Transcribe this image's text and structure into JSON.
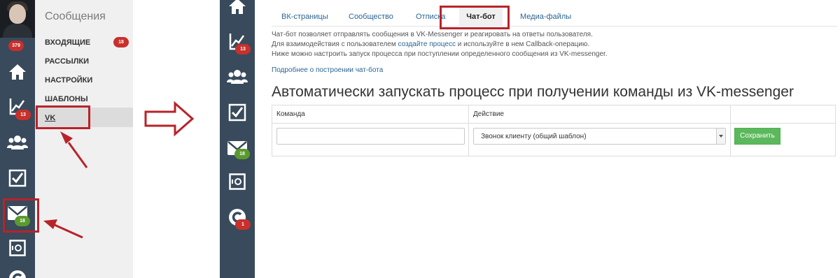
{
  "left_panel": {
    "avatar_badge": "379",
    "rail_badges": {
      "analytics": "13",
      "mail": "18"
    },
    "menu": {
      "title": "Сообщения",
      "items": [
        {
          "label": "ВХОДЯЩИЕ",
          "badge": "18"
        },
        {
          "label": "РАССЫЛКИ"
        },
        {
          "label": "НАСТРОЙКИ"
        },
        {
          "label": "ШАБЛОНЫ"
        },
        {
          "label": "VK",
          "selected": true
        }
      ]
    }
  },
  "right_panel": {
    "rail_badges": {
      "analytics": "13",
      "mail": "18",
      "c": "1"
    },
    "tabs": [
      {
        "label": "ВК-страницы"
      },
      {
        "label": "Сообщество"
      },
      {
        "label": "Отписка"
      },
      {
        "label": "Чат-бот",
        "active": true
      },
      {
        "label": "Медиа-файлы"
      }
    ],
    "description": {
      "line1": "Чат-бот позволяет отправлять сообщения в VK-Messenger и реагировать на ответы пользователя.",
      "line2_before": "Для взаимодействия с пользователем ",
      "line2_link": "создайте процесс",
      "line2_after": " и используйте в нем Callback-операцию.",
      "line3": "Ниже можно настроить запуск процесса при поступлении определенного сообщения из VK-messenger.",
      "more_link": "Подробнее о построении чат-бота"
    },
    "heading": "Автоматически запускать процесс при получении команды из VK-messenger",
    "table": {
      "col_command": "Команда",
      "col_action": "Действие",
      "command_value": "",
      "action_value": "Звонок клиенту (общий шаблон)",
      "save_label": "Сохранить"
    }
  },
  "colors": {
    "rail": "#384a5c",
    "highlight": "#b8232a",
    "badge_red": "#c9302c",
    "badge_green": "#5a9a2e",
    "save_button": "#5cb85c",
    "link": "#2a6496"
  }
}
